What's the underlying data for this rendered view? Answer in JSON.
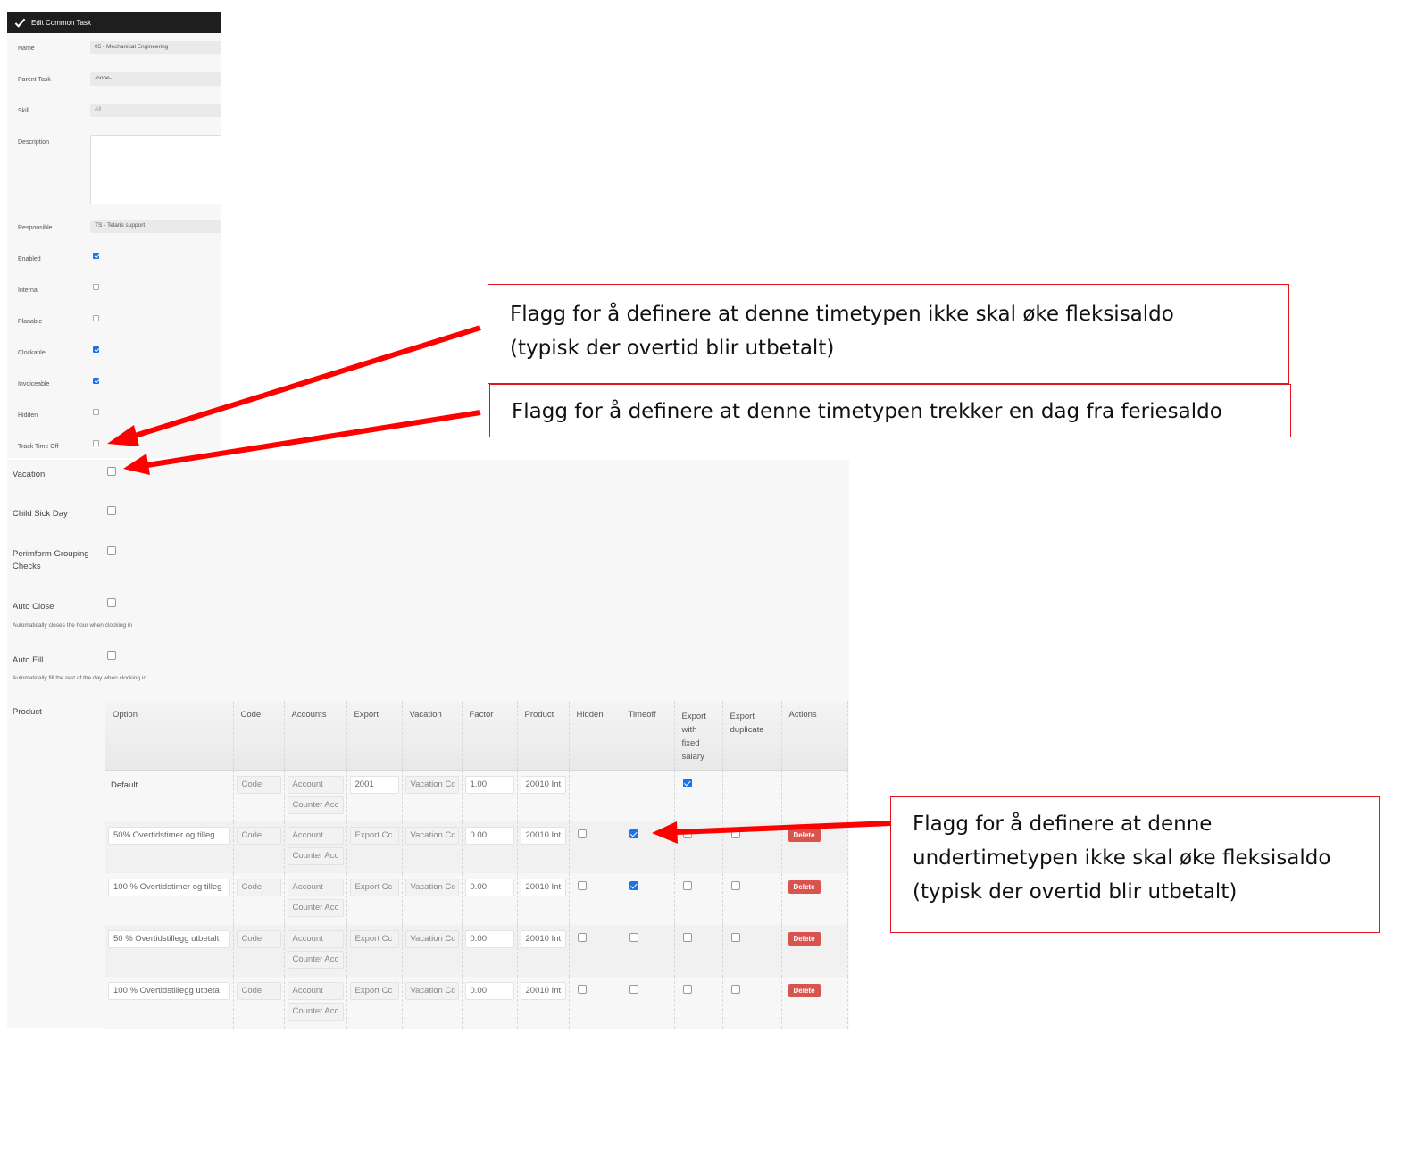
{
  "top_panel": {
    "title": "Edit Common Task",
    "fields": [
      {
        "label": "Name",
        "value": "05 - Mechanical Engineering"
      },
      {
        "label": "Parent Task",
        "value": "-none-"
      },
      {
        "label": "Skill",
        "value": "All"
      },
      {
        "label": "Description",
        "value": ""
      },
      {
        "label": "Responsible",
        "value": "TS - Telaris support"
      }
    ],
    "checks": [
      {
        "label": "Enabled",
        "checked": true
      },
      {
        "label": "Internal",
        "checked": false
      },
      {
        "label": "Planable",
        "checked": false
      },
      {
        "label": "Clockable",
        "checked": true
      },
      {
        "label": "Invoiceable",
        "checked": true
      },
      {
        "label": "Hidden",
        "checked": false
      },
      {
        "label": "Track Time Off",
        "checked": false
      }
    ]
  },
  "lower_panel": {
    "checks": [
      {
        "label": "Vacation",
        "checked": false
      },
      {
        "label": "Child Sick Day",
        "checked": false
      },
      {
        "label": "Perimform Grouping Checks",
        "checked": false
      },
      {
        "label": "Auto Close",
        "checked": false,
        "sub": "Automatically closes the hour when clocking in"
      },
      {
        "label": "Auto Fill",
        "checked": false,
        "sub": "Automatically fill the rest of the day when clocking in"
      }
    ],
    "product_label": "Product",
    "table": {
      "headers": [
        "Option",
        "Code",
        "Accounts",
        "Export",
        "Vacation",
        "Factor",
        "Product",
        "Hidden",
        "Timeoff",
        "Export with fixed salary",
        "Export duplicate",
        "Actions"
      ],
      "placeholders": {
        "code": "Code",
        "account": "Account",
        "counter_account": "Counter Acc",
        "export": "Export Cc",
        "vacation": "Vacation Cc"
      },
      "delete_label": "Delete",
      "rows": [
        {
          "option": "Default",
          "export": "2001",
          "factor": "1.00",
          "product": "20010 Int",
          "hidden": null,
          "timeoff": null,
          "fixed": true,
          "duplicate": null,
          "deletable": false
        },
        {
          "option": "50% Overtidstimer og tilleg",
          "export": "",
          "factor": "0.00",
          "product": "20010 Int",
          "hidden": false,
          "timeoff": true,
          "fixed": false,
          "duplicate": false,
          "deletable": true
        },
        {
          "option": "100 % Overtidstimer og tilleg",
          "export": "",
          "factor": "0.00",
          "product": "20010 Int",
          "hidden": false,
          "timeoff": true,
          "fixed": false,
          "duplicate": false,
          "deletable": true
        },
        {
          "option": "50 % Overtidstillegg utbetalt",
          "export": "",
          "factor": "0.00",
          "product": "20010 Int",
          "hidden": false,
          "timeoff": false,
          "fixed": false,
          "duplicate": false,
          "deletable": true
        },
        {
          "option": "100 % Overtidstillegg utbeta",
          "export": "",
          "factor": "0.00",
          "product": "20010 Int",
          "hidden": false,
          "timeoff": false,
          "fixed": false,
          "duplicate": false,
          "deletable": true
        }
      ]
    }
  },
  "callouts": {
    "flex": [
      "Flagg for å definere at denne timetypen ikke skal øke fleksisaldo",
      "(typisk der overtid blir utbetalt)"
    ],
    "vacation": [
      "Flagg for å definere at denne timetypen trekker en dag fra feriesaldo"
    ],
    "sub_flex": [
      "Flagg for å definere at denne",
      "undertimetypen ikke skal øke fleksisaldo",
      "(typisk der overtid blir utbetalt)"
    ]
  },
  "colors": {
    "callout_border": "#e0141e",
    "checkbox_on": "#1a73e8",
    "delete_button": "#d9534f",
    "titlebar": "#1e1e1e"
  }
}
